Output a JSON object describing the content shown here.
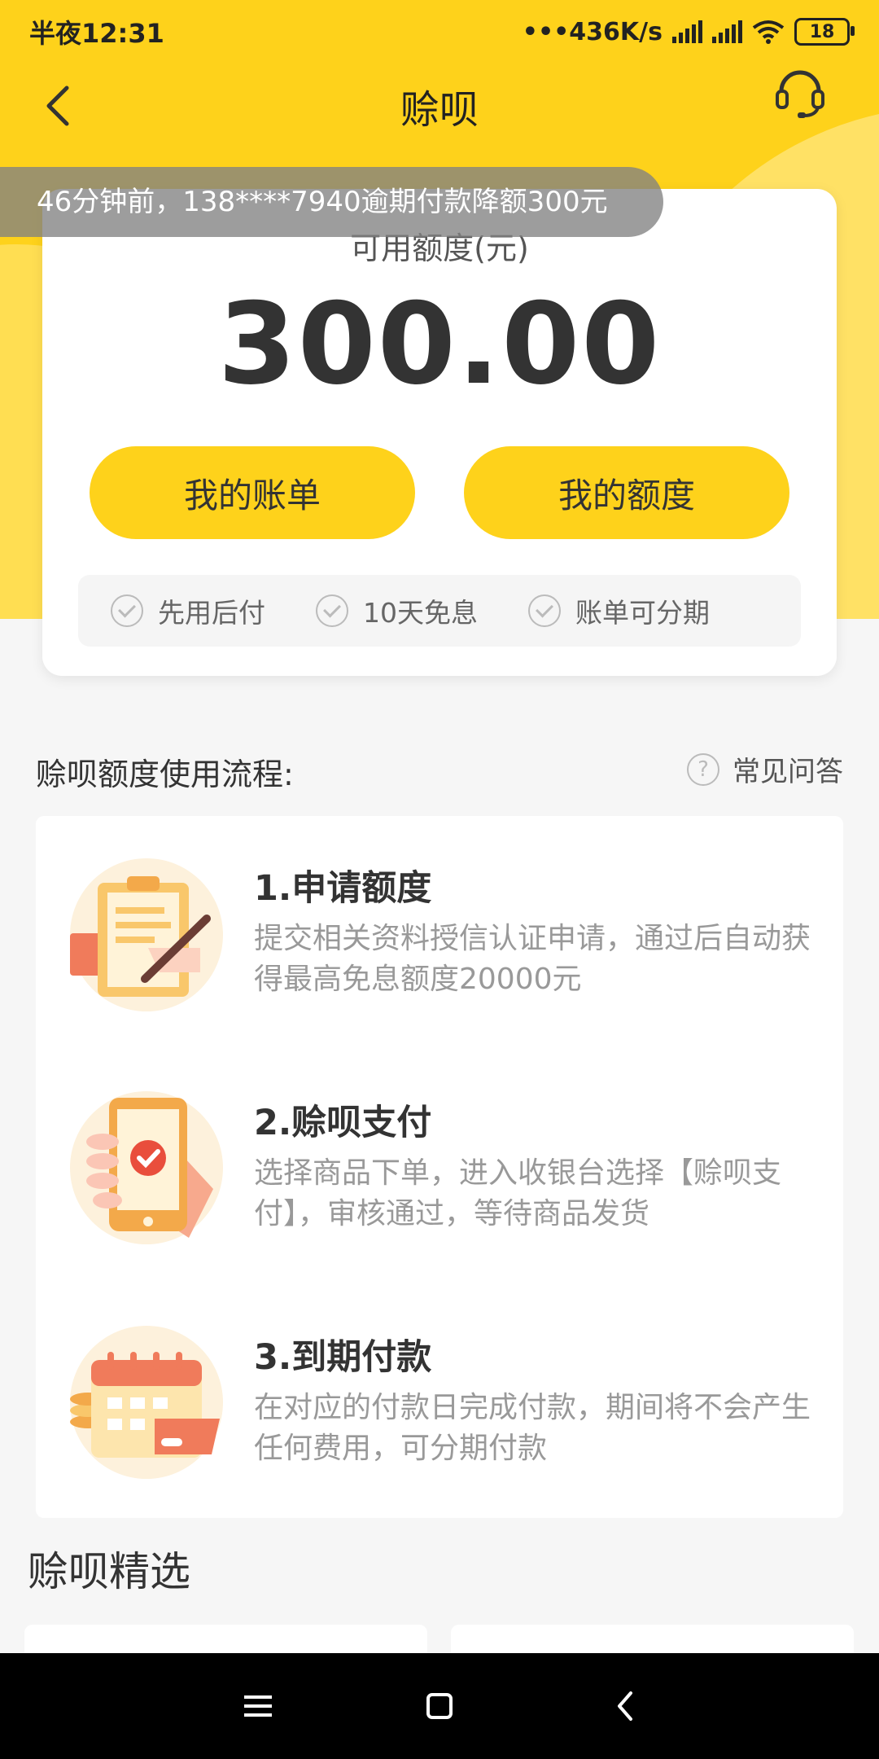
{
  "status_bar": {
    "time": "半夜12:31",
    "network_speed": "•••436K/s",
    "battery": "18"
  },
  "header": {
    "title": "赊呗",
    "back_icon": "back-arrow-icon",
    "service_icon": "headset-icon"
  },
  "ticker": {
    "text": "46分钟前，138****7940逾期付款降额300元"
  },
  "credit_card": {
    "label": "可用额度(元)",
    "amount": "300.00",
    "buttons": {
      "my_bill": "我的账单",
      "my_limit": "我的额度"
    },
    "features": [
      "先用后付",
      "10天免息",
      "账单可分期"
    ]
  },
  "process": {
    "title": "赊呗额度使用流程:",
    "faq_label": "常见问答",
    "steps": [
      {
        "title": "1.申请额度",
        "desc": "提交相关资料授信认证申请，通过后自动获得最高免息额度20000元",
        "icon": "application-form-icon"
      },
      {
        "title": "2.赊呗支付",
        "desc": "选择商品下单，进入收银台选择【赊呗支付】，审核通过，等待商品发货",
        "icon": "phone-payment-icon"
      },
      {
        "title": "3.到期付款",
        "desc": "在对应的付款日完成付款，期间将不会产生任何费用，可分期付款",
        "icon": "calendar-icon"
      }
    ]
  },
  "picks": {
    "title": "赊呗精选"
  },
  "colors": {
    "brand_yellow": "#fed21b",
    "light_yellow": "#ffe165",
    "accent_orange": "#f26c4f"
  }
}
